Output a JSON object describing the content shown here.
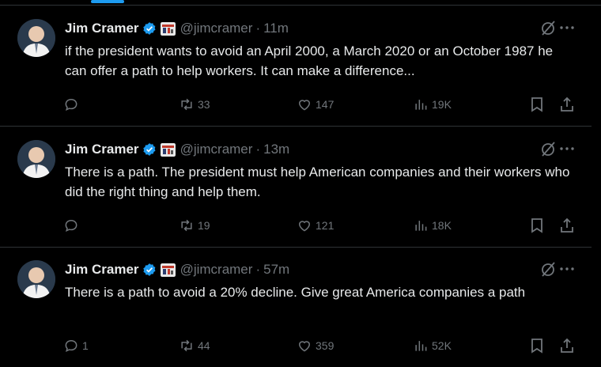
{
  "colors": {
    "background": "#000000",
    "text": "#e7e9ea",
    "muted": "#71767b",
    "verified": "#1d9bf0",
    "divider": "#2f3336"
  },
  "tweets": [
    {
      "name": "Jim Cramer",
      "handle": "@jimcramer",
      "separator": "·",
      "time": "11m",
      "text": "if the president wants to avoid an April 2000, a March 2020 or an October 1987 he can offer a path to help workers. It can make a difference...",
      "replies": "",
      "reposts": "33",
      "likes": "147",
      "views": "19K"
    },
    {
      "name": "Jim Cramer",
      "handle": "@jimcramer",
      "separator": "·",
      "time": "13m",
      "text": "There is a path. The president must help American companies and their workers who did the right thing and help them.",
      "replies": "",
      "reposts": "19",
      "likes": "121",
      "views": "18K"
    },
    {
      "name": "Jim Cramer",
      "handle": "@jimcramer",
      "separator": "·",
      "time": "57m",
      "text": "There is a path to avoid a 20% decline. Give great America companies a path",
      "replies": "1",
      "reposts": "44",
      "likes": "359",
      "views": "52K"
    }
  ],
  "icons": {
    "verified": "verified-badge-icon",
    "affiliate": "affiliate-logo-icon",
    "grok": "grok-icon",
    "more": "more-icon",
    "reply": "reply-icon",
    "repost": "repost-icon",
    "like": "like-icon",
    "views": "views-icon",
    "bookmark": "bookmark-icon",
    "share": "share-icon"
  }
}
